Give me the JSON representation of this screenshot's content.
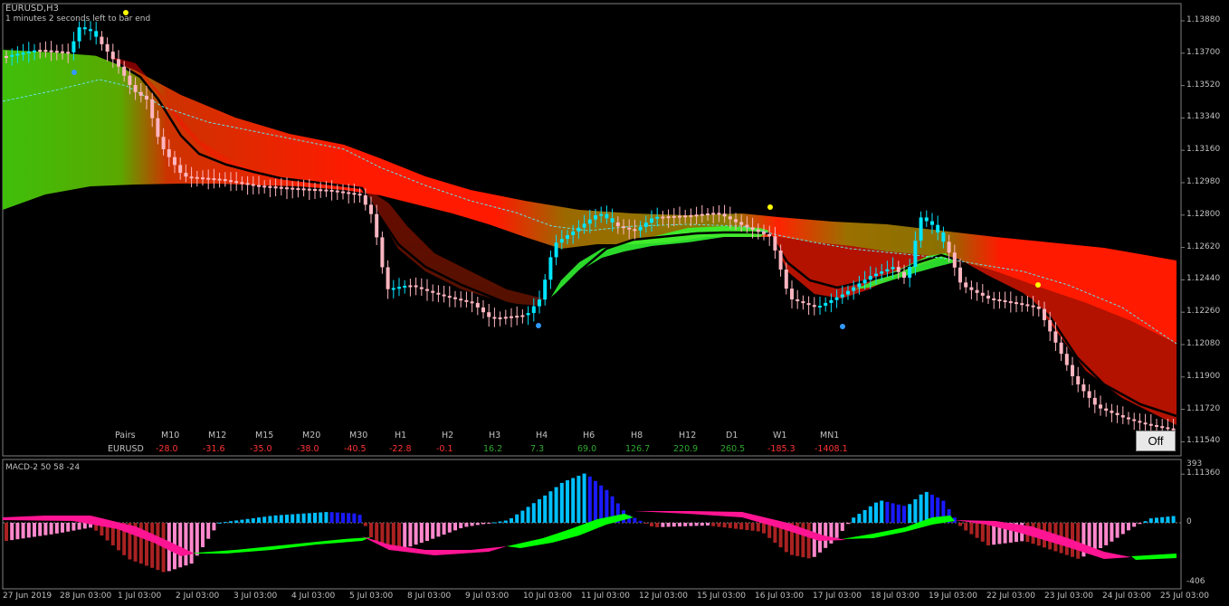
{
  "main_chart": {
    "symbol_label": "EURUSD,H3",
    "timer_label": "1 minutes 2 seconds left to bar end",
    "price_axis": [
      "1.13880",
      "1.13700",
      "1.13520",
      "1.13340",
      "1.13160",
      "1.12980",
      "1.12800",
      "1.12620",
      "1.12440",
      "1.12260",
      "1.12080",
      "1.11900",
      "1.11720",
      "1.11540",
      "1.11360"
    ]
  },
  "strength_table": {
    "pairs_header": "Pairs",
    "pair": "EURUSD",
    "columns": [
      {
        "tf": "M10",
        "value": "-28.0",
        "color": "#ff3333"
      },
      {
        "tf": "M12",
        "value": "-31.6",
        "color": "#ff3333"
      },
      {
        "tf": "M15",
        "value": "-35.0",
        "color": "#ff3333"
      },
      {
        "tf": "M20",
        "value": "-38.0",
        "color": "#ff3333"
      },
      {
        "tf": "M30",
        "value": "-40.5",
        "color": "#ff3333"
      },
      {
        "tf": "H1",
        "value": "-22.8",
        "color": "#ff3333"
      },
      {
        "tf": "H2",
        "value": "-0.1",
        "color": "#ff3333"
      },
      {
        "tf": "H3",
        "value": "16.2",
        "color": "#2ea82e"
      },
      {
        "tf": "H4",
        "value": "7.3",
        "color": "#2ea82e"
      },
      {
        "tf": "H6",
        "value": "69.0",
        "color": "#2ea82e"
      },
      {
        "tf": "H8",
        "value": "126.7",
        "color": "#2ea82e"
      },
      {
        "tf": "H12",
        "value": "220.9",
        "color": "#2ea82e"
      },
      {
        "tf": "D1",
        "value": "260.5",
        "color": "#2ea82e"
      },
      {
        "tf": "W1",
        "value": "-185.3",
        "color": "#ff3333"
      },
      {
        "tf": "MN1",
        "value": "-1408.1",
        "color": "#ff3333"
      }
    ]
  },
  "off_button": "Off",
  "macd": {
    "label": "MACD-2 50 58 -24",
    "axis": [
      "393",
      "0",
      "-406"
    ]
  },
  "time_axis": [
    "27 Jun 2019",
    "28 Jun 03:00",
    "1 Jul 03:00",
    "2 Jul 03:00",
    "3 Jul 03:00",
    "4 Jul 03:00",
    "5 Jul 03:00",
    "8 Jul 03:00",
    "9 Jul 03:00",
    "10 Jul 03:00",
    "11 Jul 03:00",
    "12 Jul 03:00",
    "15 Jul 03:00",
    "16 Jul 03:00",
    "17 Jul 03:00",
    "18 Jul 03:00",
    "19 Jul 03:00",
    "22 Jul 03:00",
    "23 Jul 03:00",
    "24 Jul 03:00",
    "25 Jul 03:00"
  ],
  "colors": {
    "bull_candle": "#00e5ff",
    "bear_candle": "#ffb6c1",
    "ribbon_bull": "#22cc00",
    "ribbon_bear": "#ff1a00",
    "ribbon_neutral": "#8a7a00",
    "macd_pos": "#1a1aff",
    "macd_pos_strong": "#00bfff",
    "macd_neg": "#aa2222",
    "macd_neg_light": "#ff88cc",
    "signal_green": "#00ff00",
    "signal_pink": "#ff1493"
  }
}
